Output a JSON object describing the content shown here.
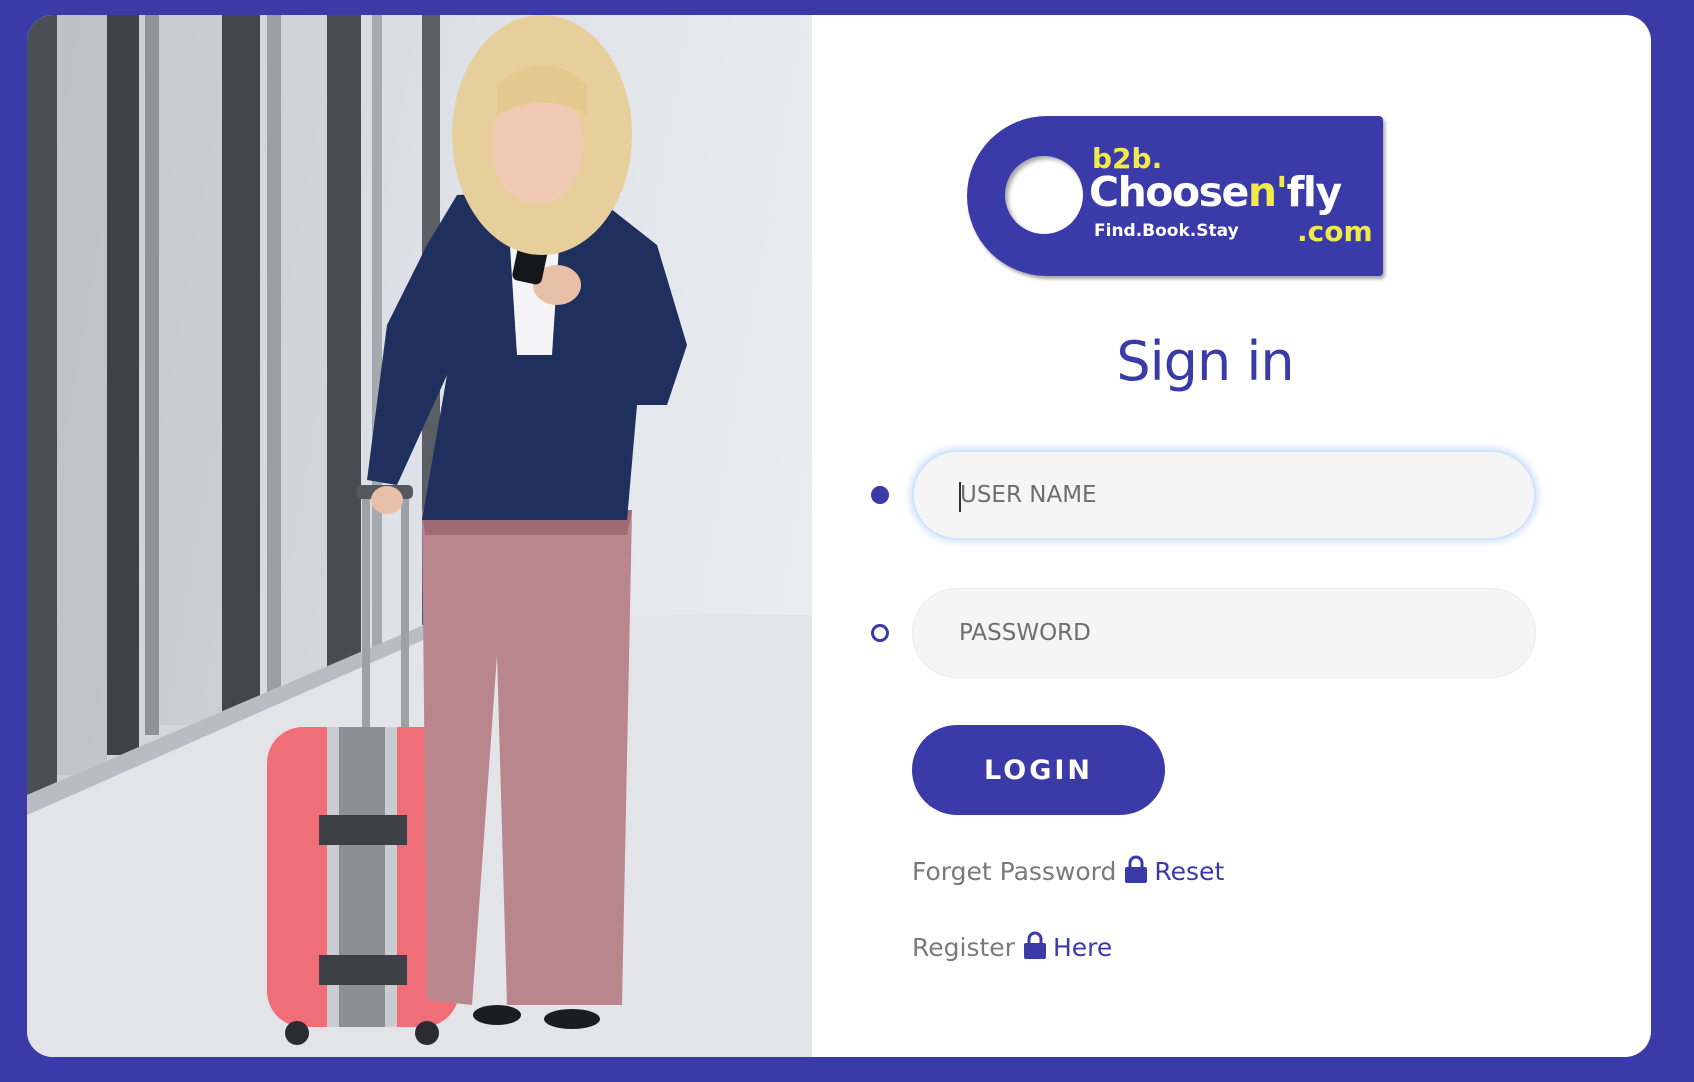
{
  "logo": {
    "prefix": "b2b.",
    "brand_main": "Choose",
    "brand_accent": "n'",
    "brand_end": "fly",
    "tagline": "Find.Book.Stay",
    "domain_suffix": ".com"
  },
  "form": {
    "title": "Sign in",
    "username": {
      "placeholder": "USER NAME",
      "value": ""
    },
    "password": {
      "placeholder": "PASSWORD",
      "value": ""
    },
    "login_label": "LOGIN"
  },
  "links": {
    "forgot_text": "Forget Password",
    "forgot_link": "Reset",
    "register_text": "Register",
    "register_link": "Here"
  },
  "colors": {
    "brand": "#3a3aa8",
    "accent_yellow": "#f2e94a",
    "field_bg": "#f5f5f5"
  }
}
